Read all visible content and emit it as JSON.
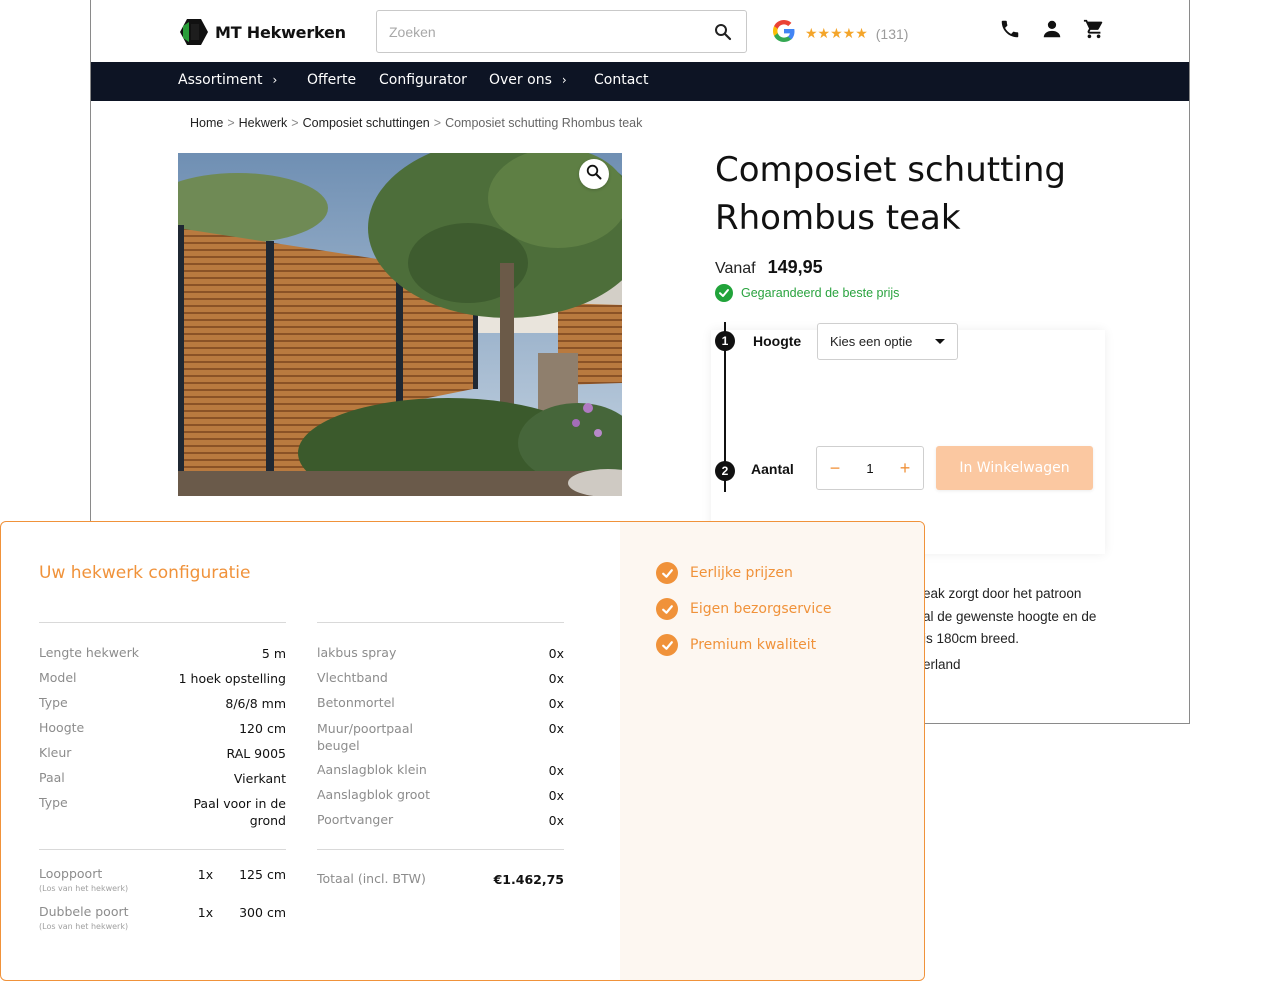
{
  "header": {
    "brand": "MT Hekwerken",
    "search_placeholder": "Zoeken",
    "rating_stars": "★★★★★",
    "review_count": "(131)"
  },
  "nav": {
    "items": [
      {
        "label": "Assortiment",
        "has_chevron": true
      },
      {
        "label": "Offerte",
        "has_chevron": false
      },
      {
        "label": "Configurator",
        "has_chevron": false
      },
      {
        "label": "Over ons",
        "has_chevron": true
      },
      {
        "label": "Contact",
        "has_chevron": false
      }
    ],
    "chevron": "›"
  },
  "breadcrumb": [
    "Home",
    "Hekwerk",
    "Composiet schuttingen",
    "Composiet schutting Rhombus teak"
  ],
  "product": {
    "title": "Composiet schutting Rhombus teak",
    "price_label": "Vanaf",
    "price_value": "149,95",
    "guarantee": "Gegarandeerd de beste prijs",
    "description_lines": [
      "eak zorgt door het patroon",
      "al de gewenste hoogte en de",
      "is 180cm breed."
    ],
    "description_extra": "erland"
  },
  "configurator": {
    "step1": {
      "number": "1",
      "label": "Hoogte",
      "select_value": "Kies een optie"
    },
    "step2": {
      "number": "2",
      "label": "Aantal",
      "quantity": "1",
      "minus": "−",
      "plus": "+"
    },
    "cart_button": "In Winkelwagen"
  },
  "config_card": {
    "title": "Uw hekwerk configuratie",
    "left_rows": [
      {
        "label": "Lengte hekwerk",
        "value": "5 m"
      },
      {
        "label": "Model",
        "value": "1 hoek opstelling"
      },
      {
        "label": "Type",
        "value": "8/6/8 mm"
      },
      {
        "label": "Hoogte",
        "value": "120 cm"
      },
      {
        "label": "Kleur",
        "value": "RAL 9005"
      },
      {
        "label": "Paal",
        "value": "Vierkant"
      },
      {
        "label": "Type",
        "value": "Paal voor in de grond"
      }
    ],
    "gates": [
      {
        "label": "Looppoort",
        "sub": "(Los van het hekwerk)",
        "qty": "1x",
        "size": "125 cm"
      },
      {
        "label": "Dubbele poort",
        "sub": "(Los van het hekwerk)",
        "qty": "1x",
        "size": "300 cm"
      }
    ],
    "extras": [
      {
        "label": "lakbus spray",
        "qty": "0x"
      },
      {
        "label": "Vlechtband",
        "qty": "0x"
      },
      {
        "label": "Betonmortel",
        "qty": "0x"
      },
      {
        "label": "Muur/poortpaal beugel",
        "qty": "0x"
      },
      {
        "label": "Aanslagblok klein",
        "qty": "0x"
      },
      {
        "label": "Aanslagblok groot",
        "qty": "0x"
      },
      {
        "label": "Poortvanger",
        "qty": "0x"
      }
    ],
    "total_label": "Totaal (incl. BTW)",
    "total_value": "€1.462,75",
    "benefits": [
      "Eerlijke prijzen",
      "Eigen bezorgservice",
      "Premium kwaliteit"
    ]
  },
  "colors": {
    "accent_orange": "#f0923a",
    "navbar": "#0d1424",
    "success_green": "#21a33a",
    "cart_button_disabled": "#fbc8a1"
  },
  "icons": [
    "search-icon",
    "google-logo-icon",
    "phone-icon",
    "user-icon",
    "cart-icon",
    "zoom-icon",
    "check-circle-icon"
  ]
}
